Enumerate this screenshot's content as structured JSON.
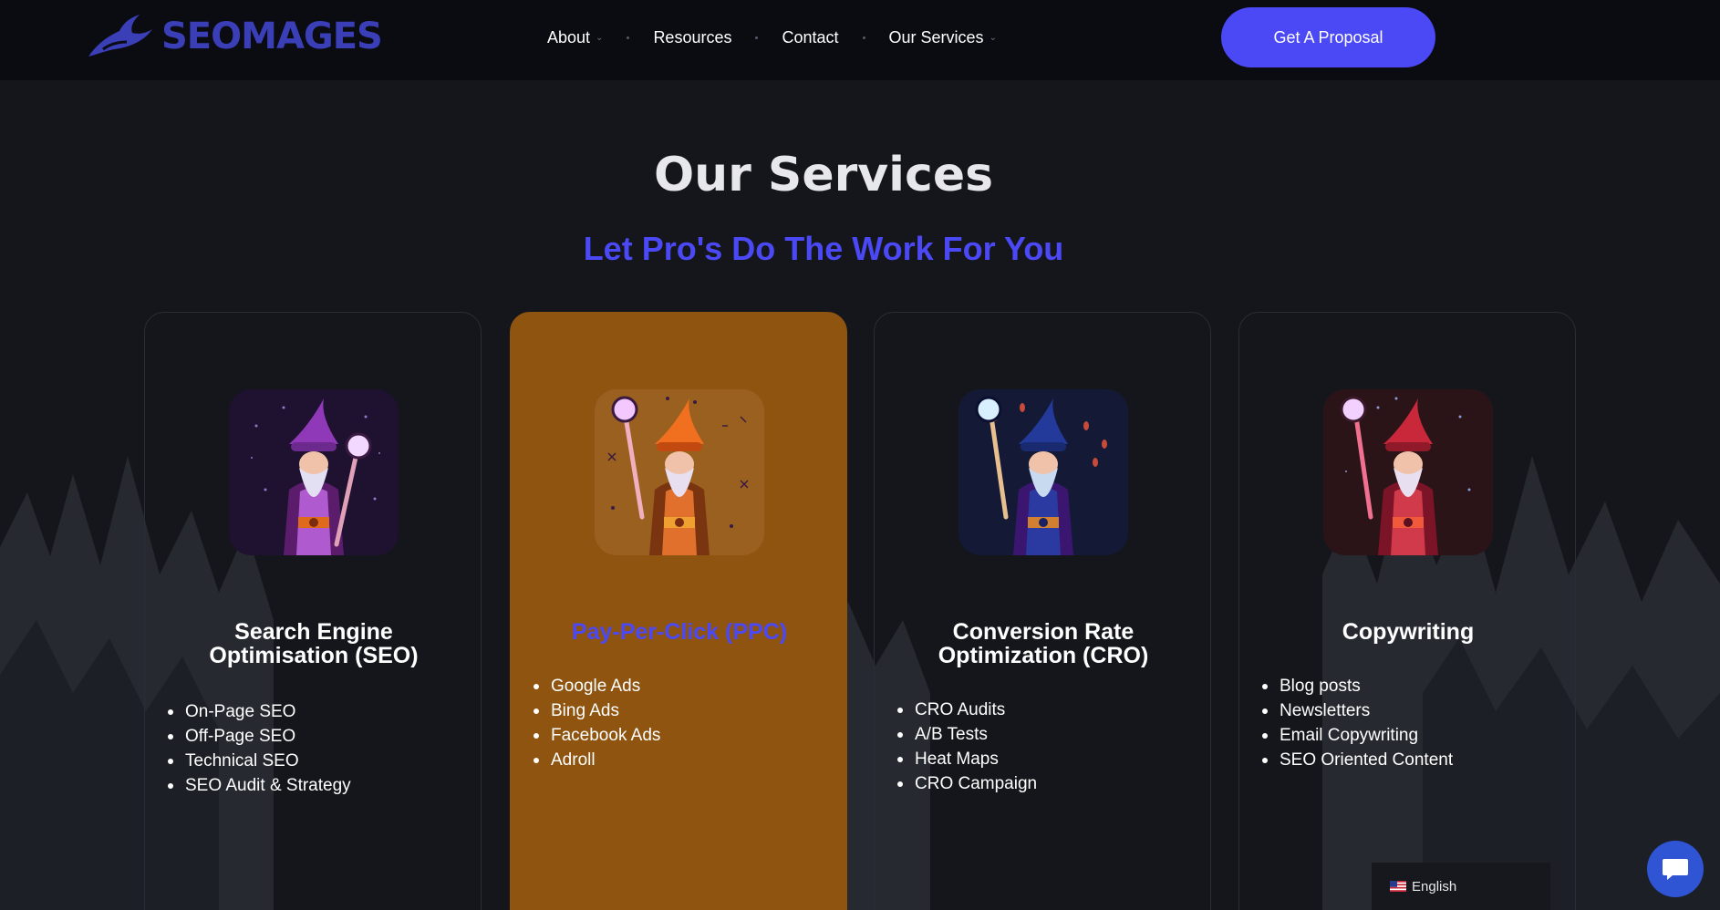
{
  "header": {
    "logo_text": "SEOMAGES",
    "nav": [
      {
        "label": "About",
        "has_dropdown": true
      },
      {
        "label": "Resources",
        "has_dropdown": false
      },
      {
        "label": "Contact",
        "has_dropdown": false
      },
      {
        "label": "Our Services",
        "has_dropdown": true
      }
    ],
    "cta_label": "Get A Proposal"
  },
  "section": {
    "title": "Our Services",
    "subtitle": "Let Pro's Do The Work For You"
  },
  "cards": [
    {
      "title": "Search Engine Optimisation (SEO)",
      "items": [
        "On-Page SEO",
        "Off-Page SEO",
        "Technical SEO",
        "SEO Audit & Strategy"
      ]
    },
    {
      "title": "Pay-Per-Click (PPC)",
      "items": [
        "Google Ads",
        "Bing Ads",
        "Facebook Ads",
        "Adroll"
      ]
    },
    {
      "title": "Conversion Rate Optimization (CRO)",
      "items": [
        "CRO Audits",
        "A/B Tests",
        "Heat Maps",
        "CRO Campaign"
      ]
    },
    {
      "title": "Copywriting",
      "items": [
        "Blog posts",
        "Newsletters",
        "Email Copywriting",
        "SEO Oriented Content"
      ]
    }
  ],
  "language": {
    "label": "English"
  },
  "colors": {
    "accent": "#4b48f5",
    "active_card": "#8e5410",
    "background": "#14161b",
    "header": "#0b0c12",
    "chat": "#2f55d4"
  },
  "icons": {
    "logo": "wizard-hat-logo-icon",
    "chat": "chat-bubble-icon",
    "flag": "us-flag-icon",
    "dropdown": "chevron-down-icon"
  }
}
